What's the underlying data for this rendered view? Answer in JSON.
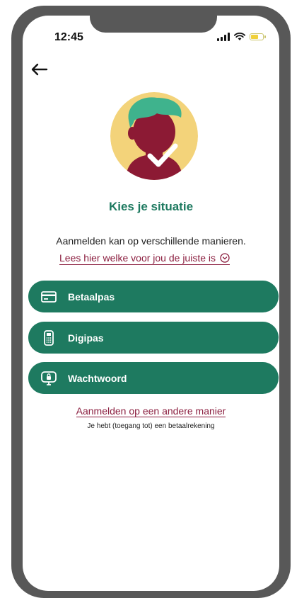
{
  "status_bar": {
    "time": "12:45"
  },
  "header": {
    "back_icon": "arrow-left-icon"
  },
  "main": {
    "avatar_icon": "user-check-avatar-icon",
    "title": "Kies je situatie",
    "intro": "Aanmelden kan op verschillende manieren.",
    "info_link": "Lees hier welke voor jou de juiste is",
    "options": [
      {
        "label": "Betaalpas",
        "icon": "card-icon"
      },
      {
        "label": "Digipas",
        "icon": "digipas-icon"
      },
      {
        "label": "Wachtwoord",
        "icon": "password-icon"
      }
    ],
    "alt_link": "Aanmelden op een andere manier",
    "alt_subtext": "Je hebt (toegang tot) een betaalrekening"
  },
  "colors": {
    "primary_green": "#1e7a60",
    "link_red": "#8b1e3f",
    "frame": "#585858",
    "avatar_bg": "#f3d37a",
    "avatar_face": "#8c1a34",
    "avatar_hair": "#3fb38d"
  }
}
